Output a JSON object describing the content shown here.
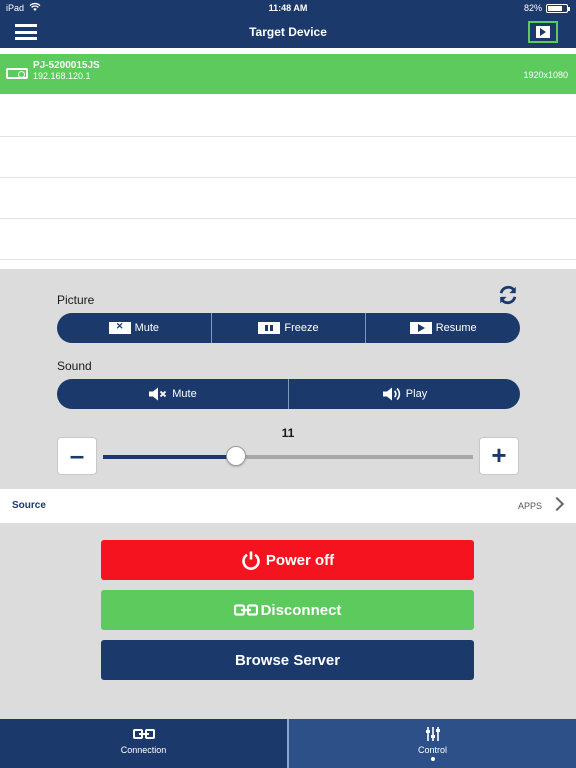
{
  "status_bar": {
    "carrier": "iPad",
    "time": "11:48 AM",
    "battery": "82%",
    "battery_level": 0.82
  },
  "header": {
    "title": "Target Device"
  },
  "devices": [
    {
      "name": "PJ-5200015JS",
      "ip": "192.168.120.1",
      "resolution": "1920x1080",
      "selected": true
    }
  ],
  "picture": {
    "label": "Picture",
    "mute_label": "Mute",
    "freeze_label": "Freeze",
    "resume_label": "Resume"
  },
  "sound": {
    "label": "Sound",
    "mute_label": "Mute",
    "play_label": "Play"
  },
  "volume": {
    "value": "11",
    "level": 0.36
  },
  "source": {
    "label": "Source",
    "value": "APPS"
  },
  "actions": {
    "power_off": "Power off",
    "disconnect": "Disconnect",
    "browse_server": "Browse Server"
  },
  "tabs": {
    "connection": "Connection",
    "control": "Control",
    "active": "control"
  },
  "colors": {
    "navy": "#1b3a6b",
    "green": "#5cca5c",
    "red": "#f5131f"
  }
}
